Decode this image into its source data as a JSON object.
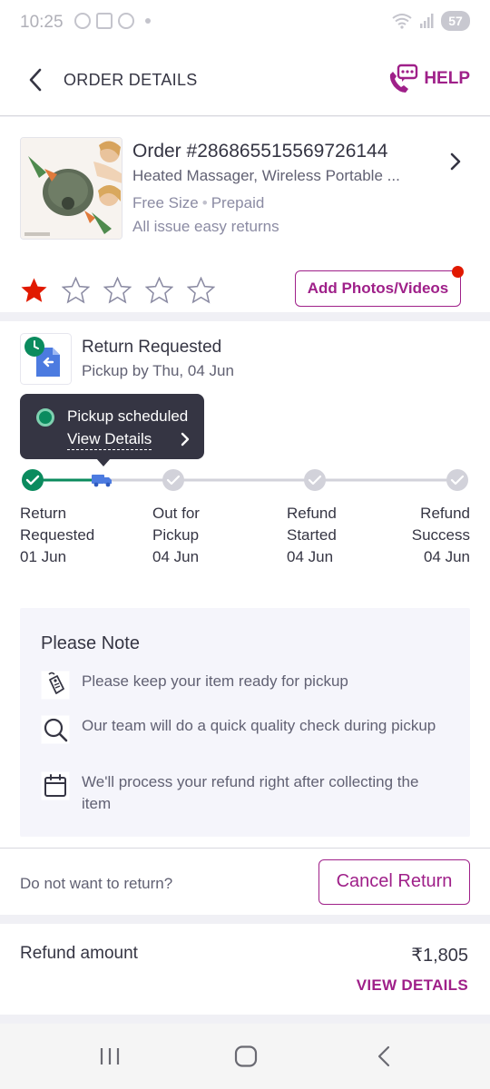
{
  "status_bar": {
    "time": "10:25",
    "battery": "57"
  },
  "header": {
    "title": "ORDER DETAILS",
    "help_label": "HELP"
  },
  "order": {
    "order_id": "Order #286865515569726144",
    "product_name": "Heated Massager, Wireless Portable ...",
    "size": "Free Size",
    "payment": "Prepaid",
    "returns_note": "All issue easy returns",
    "rating": 1,
    "rating_max": 5,
    "add_media_label": "Add Photos/Videos"
  },
  "return_status": {
    "title": "Return Requested",
    "subtitle": "Pickup by Thu, 04 Jun",
    "tooltip_text": "Pickup scheduled",
    "tooltip_link": "View Details",
    "steps": [
      {
        "label_line1": "Return",
        "label_line2": "Requested",
        "date": "01 Jun",
        "state": "done"
      },
      {
        "label_line1": "Out for",
        "label_line2": "Pickup",
        "date": "04 Jun",
        "state": "pending"
      },
      {
        "label_line1": "Refund",
        "label_line2": "Started",
        "date": "04 Jun",
        "state": "pending"
      },
      {
        "label_line1": "Refund",
        "label_line2": "Success",
        "date": "04 Jun",
        "state": "pending"
      }
    ]
  },
  "note": {
    "title": "Please Note",
    "items": [
      {
        "icon": "tag-icon",
        "text": "Please keep your item ready for pickup"
      },
      {
        "icon": "search-icon",
        "text": "Our team will do a quick quality check during pickup"
      },
      {
        "icon": "calendar-icon",
        "text": "We'll process your refund right after collecting the item"
      }
    ]
  },
  "cancel": {
    "question": "Do not want to return?",
    "button_label": "Cancel Return"
  },
  "refund": {
    "label": "Refund amount",
    "amount": "₹1,805",
    "view_details": "VIEW DETAILS"
  },
  "colors": {
    "brand": "#9f2089",
    "success": "#0b8b5e",
    "star_active": "#e11900",
    "truck": "#4c7be0"
  }
}
